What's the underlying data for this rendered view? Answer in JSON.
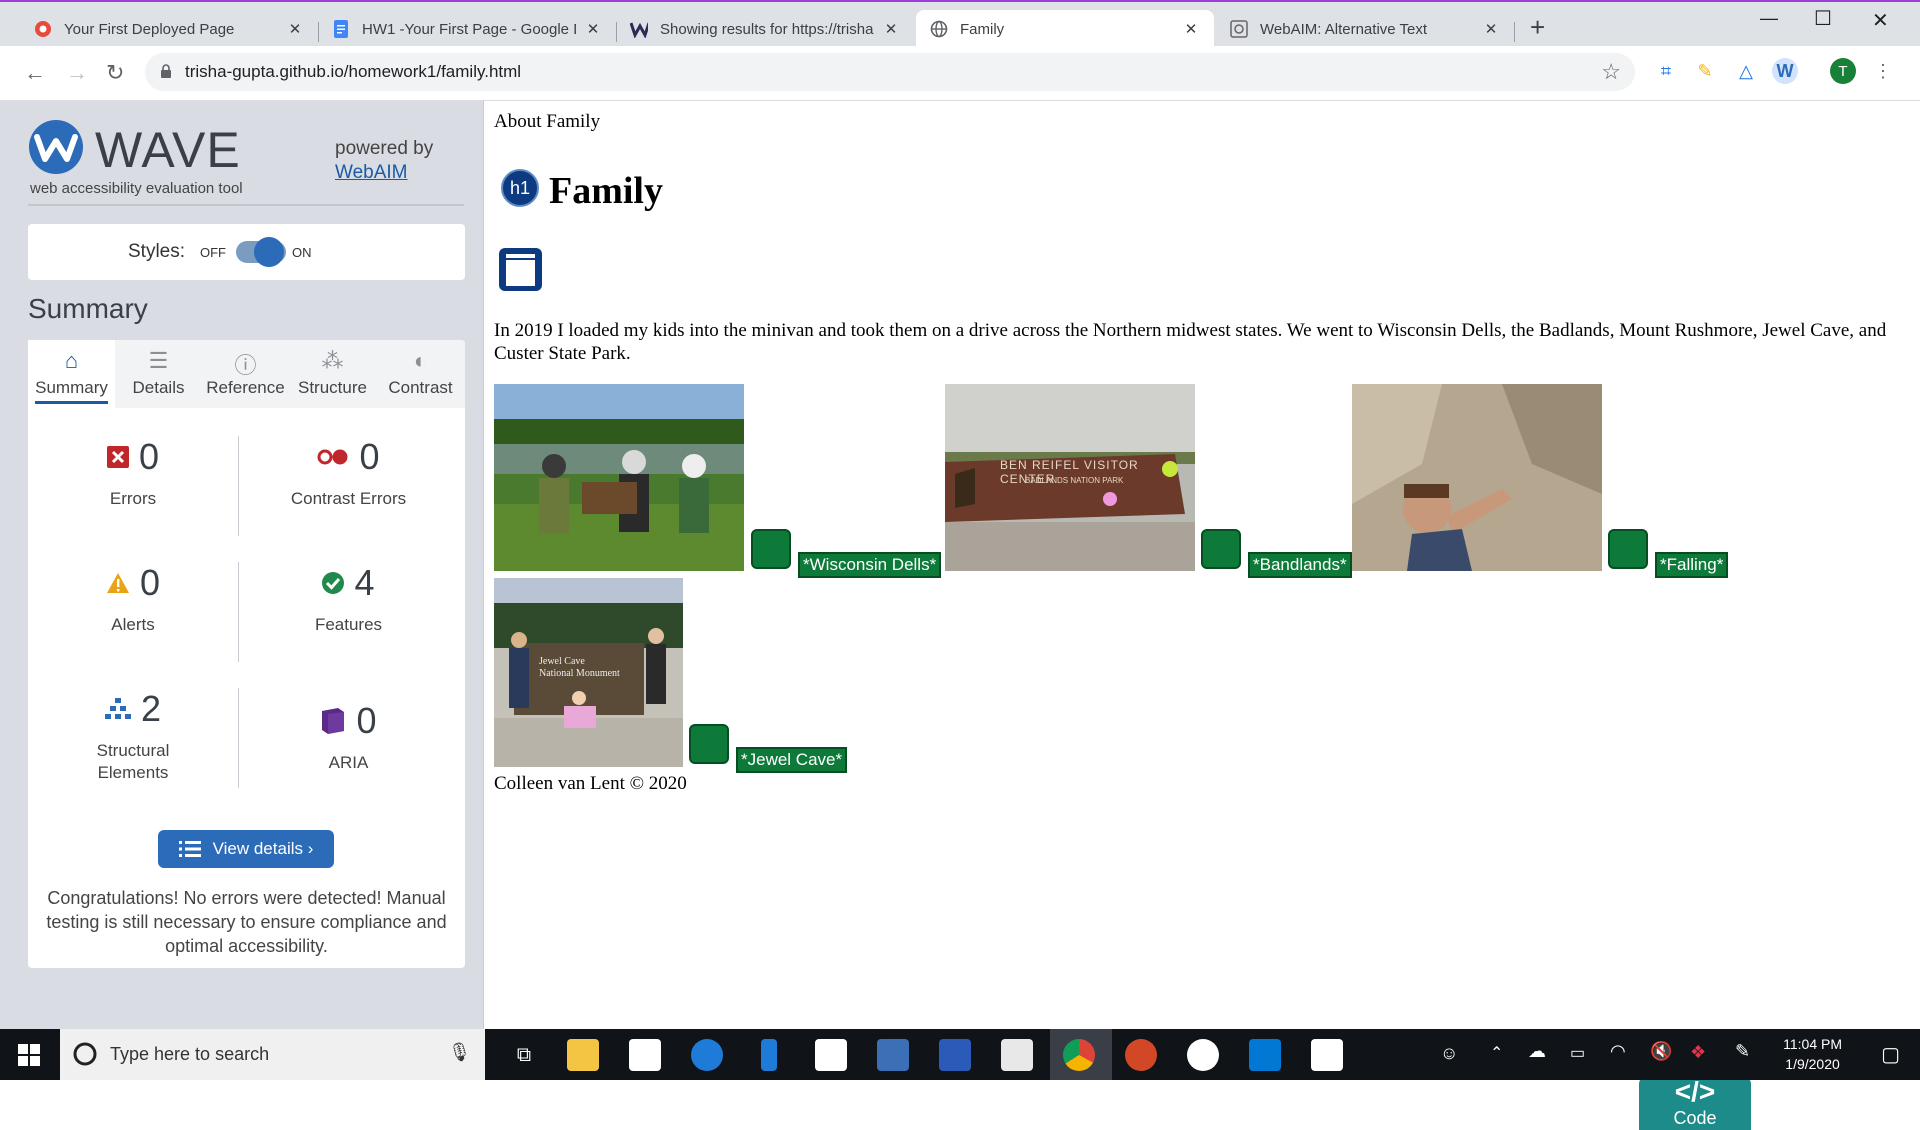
{
  "browser": {
    "tabs": [
      {
        "title": "Your First Deployed Page",
        "icon": "webaim-icon"
      },
      {
        "title": "HW1 -Your First Page - Google D",
        "icon": "google-docs-icon"
      },
      {
        "title": "Showing results for https://trisha",
        "icon": "wave-icon"
      },
      {
        "title": "Family",
        "icon": "globe-icon",
        "active": true
      },
      {
        "title": "WebAIM: Alternative Text",
        "icon": "webaim-icon"
      }
    ],
    "url": "trisha-gupta.github.io/homework1/family.html",
    "profile_initial": "T"
  },
  "wave": {
    "name": "WAVE",
    "tagline": "web accessibility evaluation tool",
    "powered_by": "powered by",
    "webaim_link": "WebAIM",
    "styles_label": "Styles:",
    "off_label": "OFF",
    "on_label": "ON",
    "summary_heading": "Summary",
    "tabs": [
      {
        "label": "Summary",
        "icon": "home-icon"
      },
      {
        "label": "Details",
        "icon": "list-icon"
      },
      {
        "label": "Reference",
        "icon": "info-icon"
      },
      {
        "label": "Structure",
        "icon": "hierarchy-icon"
      },
      {
        "label": "Contrast",
        "icon": "contrast-icon"
      }
    ],
    "stats": {
      "errors": {
        "value": "0",
        "label": "Errors"
      },
      "contrast": {
        "value": "0",
        "label": "Contrast Errors"
      },
      "alerts": {
        "value": "0",
        "label": "Alerts"
      },
      "features": {
        "value": "4",
        "label": "Features"
      },
      "structural": {
        "value": "2",
        "label": "Structural Elements"
      },
      "aria": {
        "value": "0",
        "label": "ARIA"
      }
    },
    "view_details": "View details ›",
    "congrats": "Congratulations! No errors were detected! Manual testing is still necessary to ensure compliance and optimal accessibility."
  },
  "page": {
    "about": "About Family",
    "h1_badge": "h1",
    "heading": "Family",
    "paragraph": "In 2019 I loaded my kids into the minivan and took them on a drive across the Northern midwest states. We went to Wisconsin Dells, the Badlands, Mount Rushmore, Jewel Cave, and Custer State Park.",
    "photos": [
      {
        "alt": "*Wisconsin Dells*"
      },
      {
        "alt": "*Bandlands*",
        "sign1": "BEN REIFEL VISITOR CENTER",
        "sign2": "BADLANDS NATION   PARK"
      },
      {
        "alt": "*Falling*"
      },
      {
        "alt": "*Jewel Cave*",
        "sign1": "Jewel Cave",
        "sign2": "National Monument"
      }
    ],
    "footer": "Colleen van Lent © 2020",
    "code_label": "Code",
    "code_glyph": "</>"
  },
  "taskbar": {
    "search_placeholder": "Type here to search",
    "time": "11:04 PM",
    "date": "1/9/2020"
  },
  "colors": {
    "wave_blue": "#2c6bb8",
    "feature_green": "#0e7a3a",
    "error_red": "#c0272d",
    "alert_orange": "#e8a317"
  }
}
